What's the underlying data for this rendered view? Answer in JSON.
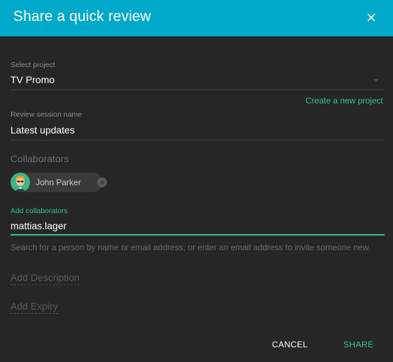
{
  "header": {
    "title": "Share a quick review",
    "close_icon": "close-icon"
  },
  "project": {
    "label": "Select project",
    "value": "TV Promo",
    "arrow_icon": "dropdown-arrow-icon"
  },
  "create_link": "Create a new project",
  "session": {
    "label": "Review session name",
    "value": "Latest updates"
  },
  "collaborators": {
    "heading": "Collaborators",
    "chips": [
      {
        "name": "John Parker",
        "avatar": "avatar-icon",
        "remove_icon": "remove-chip-icon"
      }
    ]
  },
  "add_collaborators": {
    "label": "Add collaborators",
    "value": "mattias.lager",
    "helper": "Search for a person by name or email address, or enter an email address to invite someone new."
  },
  "description": {
    "label": "Add Description"
  },
  "expiry": {
    "label": "Add Expiry"
  },
  "actions": {
    "cancel": "CANCEL",
    "share": "SHARE"
  },
  "colors": {
    "header": "#00a9c9",
    "accent": "#2fc78e",
    "background": "#262626"
  }
}
